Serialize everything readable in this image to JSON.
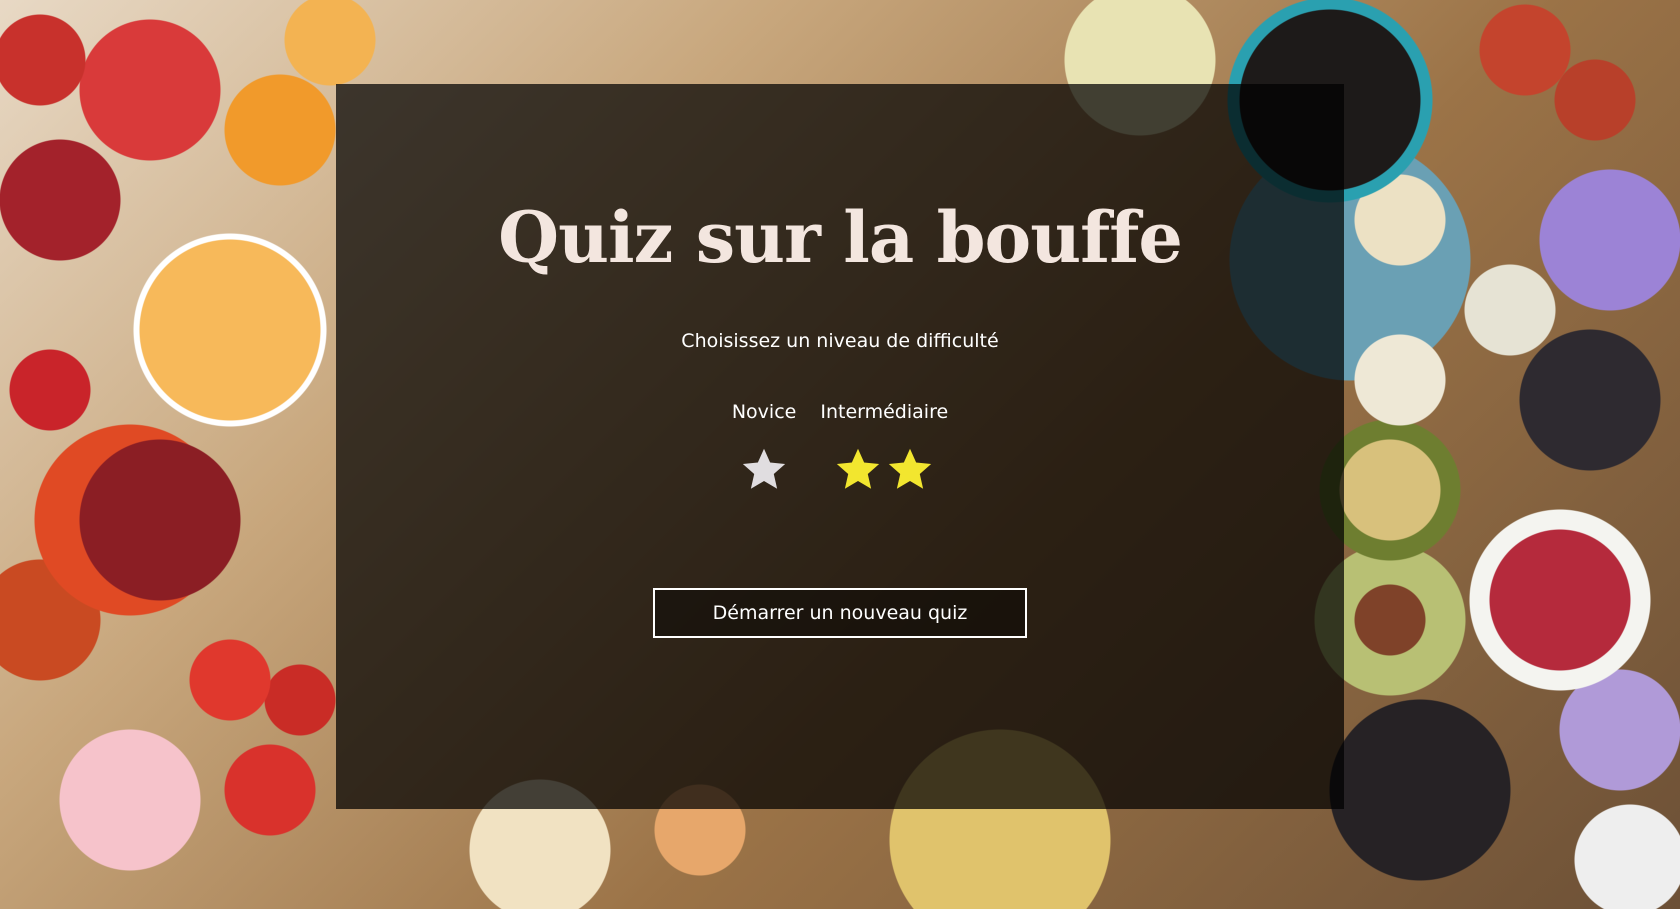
{
  "quiz": {
    "title": "Quiz sur la bouffe",
    "subtitle": "Choisissez un niveau de difficulté",
    "levels": [
      {
        "label": "Novice",
        "stars": 1,
        "star_color": "#e0dde0"
      },
      {
        "label": "Intermédiaire",
        "stars": 2,
        "star_color": "#f2e62f"
      }
    ],
    "start_button_label": "Démarrer un nouveau quiz"
  },
  "colors": {
    "panel_overlay": "#000000",
    "title": "#f3e6df",
    "text": "#ffffff"
  }
}
